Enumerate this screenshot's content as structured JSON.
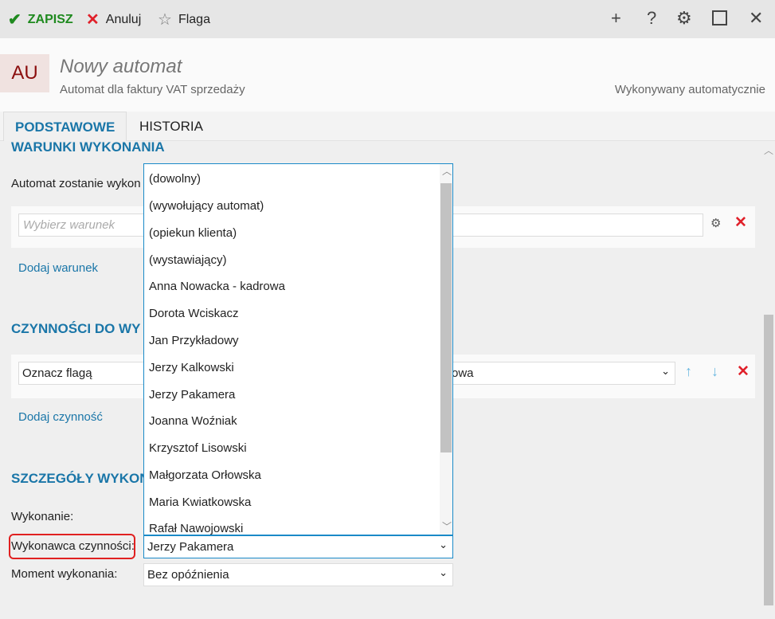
{
  "toolbar": {
    "save": "ZAPISZ",
    "cancel": "Anuluj",
    "flag": "Flaga"
  },
  "header": {
    "initials": "AU",
    "title": "Nowy automat",
    "subtitle": "Automat dla faktury VAT sprzedaży",
    "mode": "Wykonywany automatycznie"
  },
  "tabs": [
    "PODSTAWOWE",
    "HISTORIA"
  ],
  "conditions": {
    "heading": "WARUNKI WYKONANIA",
    "intro": "Automat zostanie wykon",
    "placeholder": "Wybierz warunek",
    "add": "Dodaj warunek"
  },
  "actions": {
    "heading": "CZYNNOŚCI DO WY",
    "action": "Oznacz flagą",
    "value": "owa",
    "add": "Dodaj czynność"
  },
  "details": {
    "heading": "SZCZEGÓŁY WYKON",
    "execution_label": "Wykonanie:",
    "performer_label": "Wykonawca czynności:",
    "performer_value": "Jerzy Pakamera",
    "moment_label": "Moment wykonania:",
    "moment_value": "Bez opóźnienia"
  },
  "dropdown_options": [
    "(dowolny)",
    "(wywołujący automat)",
    "(opiekun klienta)",
    "(wystawiający)",
    "Anna Nowacka - kadrowa",
    "Dorota Wciskacz",
    "Jan Przykładowy",
    "Jerzy Kalkowski",
    "Jerzy Pakamera",
    "Joanna Woźniak",
    "Krzysztof Lisowski",
    "Małgorzata Orłowska",
    "Maria Kwiatkowska",
    "Rafał Nawojowski"
  ]
}
